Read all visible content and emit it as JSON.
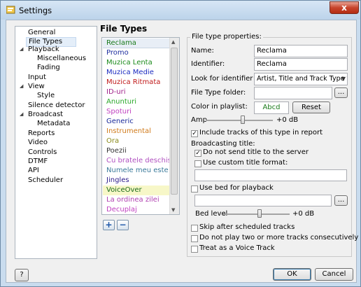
{
  "window": {
    "title": "Settings",
    "close_label": "x"
  },
  "nav": {
    "items": [
      {
        "label": "General"
      },
      {
        "label": "File Types"
      },
      {
        "label": "Playback"
      },
      {
        "label": "Miscellaneous"
      },
      {
        "label": "Fading"
      },
      {
        "label": "Input"
      },
      {
        "label": "View"
      },
      {
        "label": "Style"
      },
      {
        "label": "Silence detector"
      },
      {
        "label": "Broadcast"
      },
      {
        "label": "Metadata"
      },
      {
        "label": "Reports"
      },
      {
        "label": "Video"
      },
      {
        "label": "Controls"
      },
      {
        "label": "DTMF"
      },
      {
        "label": "API"
      },
      {
        "label": "Scheduler"
      }
    ]
  },
  "file_types": {
    "title": "File Types",
    "items": [
      {
        "label": "Reclama",
        "color": "#1a7a1a"
      },
      {
        "label": "Promo",
        "color": "#1f2f9f"
      },
      {
        "label": "Muzica Lenta",
        "color": "#1a8a1a"
      },
      {
        "label": "Muzica Medie",
        "color": "#1a2ac0"
      },
      {
        "label": "Muzica Ritmata",
        "color": "#c01a1a"
      },
      {
        "label": "ID-uri",
        "color": "#a0208a"
      },
      {
        "label": "Anunturi",
        "color": "#2aa82a"
      },
      {
        "label": "Spoturi",
        "color": "#c040c0"
      },
      {
        "label": "Generic",
        "color": "#1a2a9a"
      },
      {
        "label": "Instrumental",
        "color": "#d07a1a"
      },
      {
        "label": "Ora",
        "color": "#8a8a1a"
      },
      {
        "label": "Poezii",
        "color": "#333333"
      },
      {
        "label": "Cu bratele deschise",
        "color": "#b050c0"
      },
      {
        "label": "Numele meu este f...",
        "color": "#3a7a9a"
      },
      {
        "label": "Jingles",
        "color": "#2a1a8a"
      },
      {
        "label": "VoiceOver",
        "color": "#1a6a1a"
      },
      {
        "label": "La ordinea zilei",
        "color": "#b040b0"
      },
      {
        "label": "Decuplaj",
        "color": "#c040c0"
      }
    ],
    "add_label": "+",
    "remove_label": "−"
  },
  "props": {
    "legend": "File type properties:",
    "name_label": "Name:",
    "name_value": "Reclama",
    "identifier_label": "Identifier:",
    "identifier_value": "Reclama",
    "look_label": "Look for identifier in:",
    "look_value": "Artist, Title and Track Type ta",
    "folder_label": "File Type folder:",
    "folder_value": "",
    "browse_label": "...",
    "color_label": "Color in playlist:",
    "color_value": "Abcd",
    "reset_label": "Reset",
    "amp_label": "Amp",
    "amp_value": "+0 dB",
    "amp_level": 0.55,
    "include_label": "Include tracks of this type in report",
    "include_checked": "✓",
    "broadcast_title_label": "Broadcasting title:",
    "no_send_label": "Do not send title to the server",
    "no_send_checked": "✓",
    "custom_title_label": "Use custom title format:",
    "custom_title_value": "",
    "use_bed_label": "Use bed for playback",
    "bed_value": "",
    "bed_level_label": "Bed level",
    "bed_level_value": "+0 dB",
    "bed_level_level": 0.55,
    "skip_label": "Skip after scheduled tracks",
    "no_consec_label": "Do not play two or more tracks consecutively",
    "voice_label": "Treat as a Voice Track"
  },
  "footer": {
    "help_label": "?",
    "ok_label": "OK",
    "cancel_label": "Cancel"
  }
}
